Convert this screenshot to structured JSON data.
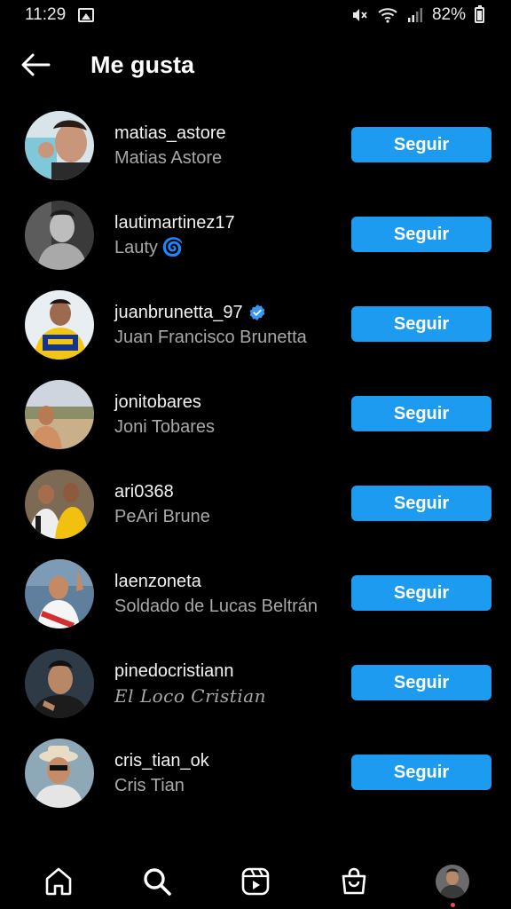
{
  "status_bar": {
    "time": "11:29",
    "battery": "82%",
    "icons": [
      "gallery-icon",
      "mute-icon",
      "wifi-icon",
      "signal-icon",
      "battery-icon"
    ]
  },
  "header": {
    "title": "Me gusta",
    "back_icon": "arrow-left-icon"
  },
  "likers": [
    {
      "username": "matias_astore",
      "full_name": "Matias Astore",
      "button": "Seguir",
      "verified": false
    },
    {
      "username": "lautimartinez17",
      "full_name": "Lauty",
      "name_emoji": "🌀",
      "button": "Seguir",
      "verified": false
    },
    {
      "username": "juanbrunetta_97",
      "full_name": "Juan Francisco Brunetta",
      "button": "Seguir",
      "verified": true
    },
    {
      "username": "jonitobares",
      "full_name": "Joni Tobares",
      "button": "Seguir",
      "verified": false
    },
    {
      "username": "ari0368",
      "full_name": "PeAri Brune",
      "button": "Seguir",
      "verified": false
    },
    {
      "username": "laenzoneta",
      "full_name": "Soldado de Lucas Beltrán",
      "button": "Seguir",
      "verified": false
    },
    {
      "username": "pinedocristiann",
      "full_name": "El Loco Cristian",
      "button": "Seguir",
      "verified": false
    },
    {
      "username": "cris_tian_ok",
      "full_name": "Cris Tian",
      "button": "Seguir",
      "verified": false
    }
  ],
  "colors": {
    "background": "#000000",
    "button": "#1d9bf0",
    "verified": "#3897f0",
    "secondary_text": "#a8a8a8",
    "notification_dot": "#ed4956"
  },
  "bottom_nav": [
    "home-icon",
    "search-icon",
    "reels-icon",
    "shop-icon",
    "profile-avatar"
  ]
}
